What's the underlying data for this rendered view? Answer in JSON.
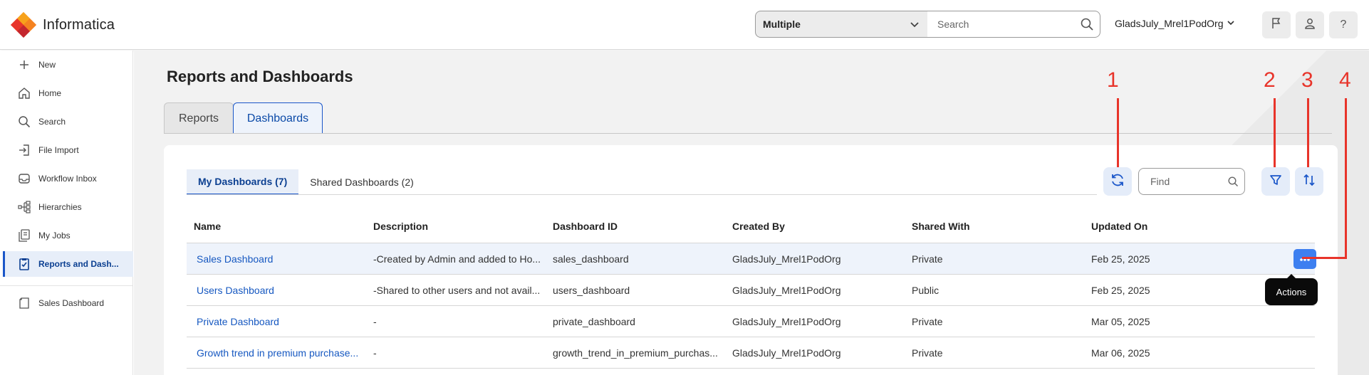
{
  "header": {
    "app_name": "Informatica",
    "scope_value": "Multiple",
    "search_placeholder": "Search",
    "org_name": "GladsJuly_Mrel1PodOrg"
  },
  "sidebar": {
    "items": [
      {
        "label": "New",
        "icon": "plus-icon"
      },
      {
        "label": "Home",
        "icon": "home-icon"
      },
      {
        "label": "Search",
        "icon": "search-icon"
      },
      {
        "label": "File Import",
        "icon": "file-import-icon"
      },
      {
        "label": "Workflow Inbox",
        "icon": "inbox-icon"
      },
      {
        "label": "Hierarchies",
        "icon": "hierarchy-icon"
      },
      {
        "label": "My Jobs",
        "icon": "jobs-icon"
      },
      {
        "label": "Reports and Dash...",
        "icon": "reports-icon",
        "active": true
      },
      {
        "label": "Sales Dashboard",
        "icon": "dashboard-icon"
      }
    ]
  },
  "main": {
    "title": "Reports and Dashboards",
    "tabs": [
      {
        "label": "Reports"
      },
      {
        "label": "Dashboards",
        "active": true
      }
    ],
    "subtabs": [
      {
        "label": "My Dashboards (7)",
        "active": true
      },
      {
        "label": "Shared Dashboards (2)"
      }
    ],
    "find_placeholder": "Find",
    "table": {
      "headers": [
        "Name",
        "Description",
        "Dashboard ID",
        "Created By",
        "Shared With",
        "Updated On"
      ],
      "rows": [
        {
          "name": "Sales Dashboard",
          "description": "-Created by Admin and added to Ho...",
          "id": "sales_dashboard",
          "created_by": "GladsJuly_Mrel1PodOrg",
          "shared_with": "Private",
          "updated_on": "Feb 25, 2025"
        },
        {
          "name": "Users Dashboard",
          "description": "-Shared to other users and not avail...",
          "id": "users_dashboard",
          "created_by": "GladsJuly_Mrel1PodOrg",
          "shared_with": "Public",
          "updated_on": "Feb 25, 2025"
        },
        {
          "name": "Private Dashboard",
          "description": "-",
          "id": "private_dashboard",
          "created_by": "GladsJuly_Mrel1PodOrg",
          "shared_with": "Private",
          "updated_on": "Mar 05, 2025"
        },
        {
          "name": "Growth trend in premium purchase...",
          "description": "-",
          "id": "growth_trend_in_premium_purchas...",
          "created_by": "GladsJuly_Mrel1PodOrg",
          "shared_with": "Private",
          "updated_on": "Mar 06, 2025"
        }
      ]
    },
    "tooltip": "Actions"
  },
  "annotations": [
    "1",
    "2",
    "3",
    "4"
  ],
  "colors": {
    "accent": "#1a56c9",
    "link": "#1658c1",
    "annotation": "#e8342a",
    "actions_button": "#3d7ff0"
  }
}
